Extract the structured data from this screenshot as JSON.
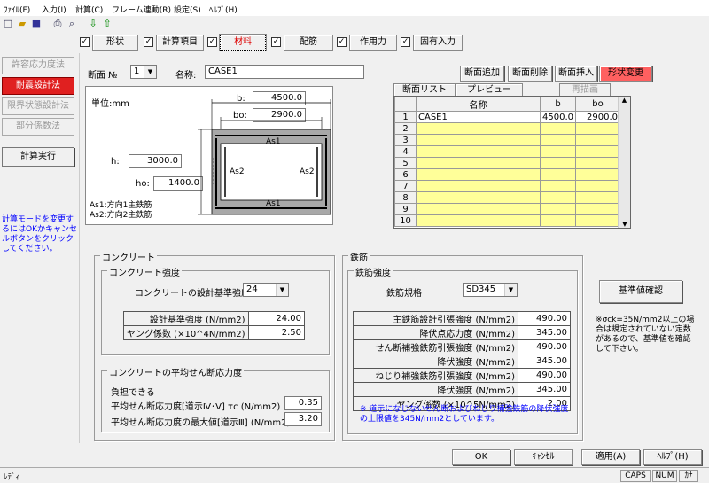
{
  "menu": [
    "ﾌｧｲﾙ(F)",
    "入力(I)",
    "計算(C)",
    "フレーム連動(R)",
    "設定(S)",
    "ﾍﾙﾌﾟ(H)"
  ],
  "tabs": [
    "形状",
    "計算項目",
    "材料",
    "配筋",
    "作用力",
    "固有入力"
  ],
  "left": {
    "buttons": [
      "許容応力度法",
      "耐震設計法",
      "限界状態設計法",
      "部分係数法"
    ],
    "calc": "計算実行",
    "note": "計算モードを変更するにはOKかキャンセルボタンをクリックしてください。"
  },
  "header": {
    "section_no_label": "断面 №",
    "section_no": "1",
    "name_label": "名称:",
    "name_value": "CASE1",
    "btn_add": "断面追加",
    "btn_delete": "断面削除",
    "btn_insert": "断面挿入",
    "btn_shape": "形状変更"
  },
  "diagram": {
    "unit": "単位:mm",
    "b_label": "b:",
    "b_value": "4500.0",
    "bo_label": "bo:",
    "bo_value": "2900.0",
    "h_label": "h:",
    "h_value": "3000.0",
    "ho_label": "ho:",
    "ho_value": "1400.0",
    "as1": "As1",
    "as2": "As2",
    "legend1": "As1:方向1主鉄筋",
    "legend2": "As2:方向2主鉄筋"
  },
  "grid_tabs": {
    "list": "断面リスト",
    "preview": "プレビュー",
    "redraw": "再描画"
  },
  "grid": {
    "headers": [
      "名称",
      "b",
      "bo"
    ],
    "rows": [
      {
        "no": "1",
        "name": "CASE1",
        "b": "4500.0",
        "bo": "2900.0"
      },
      {
        "no": "2",
        "name": "",
        "b": "",
        "bo": ""
      },
      {
        "no": "3",
        "name": "",
        "b": "",
        "bo": ""
      },
      {
        "no": "4",
        "name": "",
        "b": "",
        "bo": ""
      },
      {
        "no": "5",
        "name": "",
        "b": "",
        "bo": ""
      },
      {
        "no": "6",
        "name": "",
        "b": "",
        "bo": ""
      },
      {
        "no": "7",
        "name": "",
        "b": "",
        "bo": ""
      },
      {
        "no": "8",
        "name": "",
        "b": "",
        "bo": ""
      },
      {
        "no": "9",
        "name": "",
        "b": "",
        "bo": ""
      },
      {
        "no": "10",
        "name": "",
        "b": "",
        "bo": ""
      }
    ]
  },
  "concrete": {
    "title": "コンクリート",
    "strength_title": "コンクリート強度",
    "design_label": "コンクリートの設計基準強度",
    "design_value": "24",
    "rows": [
      {
        "k": "設計基準強度 (N/mm2)",
        "v": "24.00"
      },
      {
        "k": "ヤング係数 (×10^4N/mm2)",
        "v": "2.50"
      }
    ],
    "shear_title": "コンクリートの平均せん断応力度",
    "shear_sub": "負担できる",
    "shear1_label": "平均せん断応力度[道示Ⅳ･Ⅴ] τc (N/mm2)",
    "shear1_value": "0.35",
    "shear2_label": "平均せん断応力度の最大値[道示Ⅲ] (N/mm2)",
    "shear2_value": "3.20"
  },
  "steel": {
    "title": "鉄筋",
    "strength_title": "鉄筋強度",
    "grade_label": "鉄筋規格",
    "grade_value": "SD345",
    "rows": [
      {
        "k": "主鉄筋設計引張強度 (N/mm2)",
        "v": "490.00"
      },
      {
        "k": "降伏点応力度 (N/mm2)",
        "v": "345.00"
      },
      {
        "k": "せん断補強鉄筋引張強度 (N/mm2)",
        "v": "490.00"
      },
      {
        "k": "降伏強度 (N/mm2)",
        "v": "345.00"
      },
      {
        "k": "ねじり補強鉄筋引張強度 (N/mm2)",
        "v": "490.00"
      },
      {
        "k": "降伏強度 (N/mm2)",
        "v": "345.00"
      },
      {
        "k": "ヤング係数 (×10^5N/mm2)",
        "v": "2.00"
      }
    ],
    "note": "※ 道示になじないせん断およびねじり補強鉄筋の降伏強度の上限値を345N/mm2としています。"
  },
  "confirm_btn": "基準値確認",
  "side_note": "※σck=35N/mm2以上の場合は規定されていない定数があるので、基準値を確認して下さい。",
  "footer": {
    "ok": "OK",
    "cancel": "ｷｬﾝｾﾙ",
    "apply": "適用(A)",
    "help": "ﾍﾙﾌﾟ(H)"
  },
  "status": {
    "left": "ﾚﾃﾞｨ",
    "caps": "CAPS",
    "num": "NUM",
    "kana": "ｶﾅ"
  }
}
